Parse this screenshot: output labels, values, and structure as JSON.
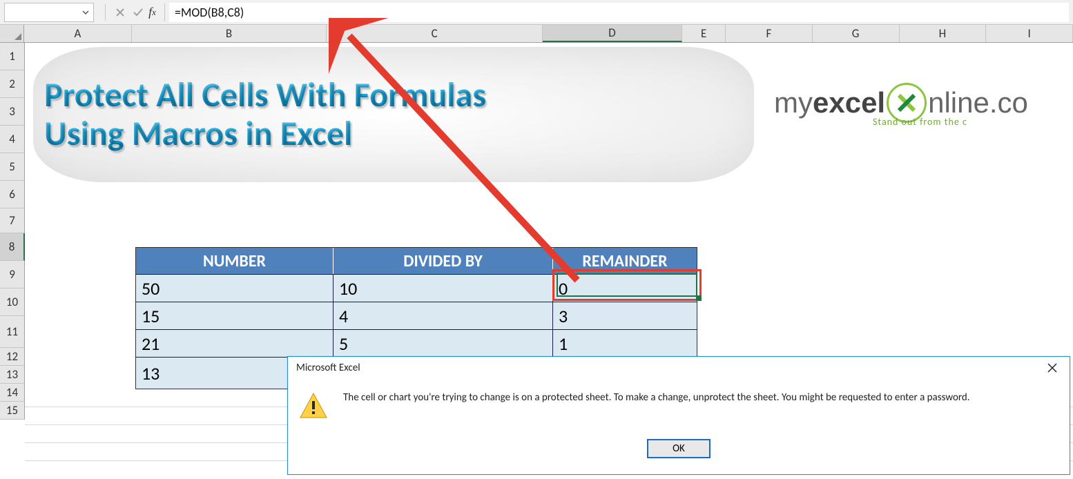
{
  "formula_bar": {
    "name_box_value": "",
    "formula": "=MOD(B8,C8)"
  },
  "columns": [
    "A",
    "B",
    "C",
    "D",
    "E",
    "F",
    "G",
    "H",
    "I"
  ],
  "rows": [
    "1",
    "2",
    "3",
    "4",
    "5",
    "6",
    "7",
    "8",
    "9",
    "10",
    "11",
    "12",
    "13",
    "14",
    "15"
  ],
  "selected_column": "D",
  "selected_row": "8",
  "title_line1": "Protect All Cells With Formulas",
  "title_line2": "Using Macros in Excel",
  "logo": {
    "p1": "my",
    "p2": "excel",
    "p3": "nline.co",
    "tag": "Stand out from the c"
  },
  "table": {
    "headers": {
      "number": "NUMBER",
      "divided_by": "DIVIDED BY",
      "remainder": "REMAINDER"
    },
    "rows": [
      {
        "number": "50",
        "divided_by": "10",
        "remainder": "0"
      },
      {
        "number": "15",
        "divided_by": "4",
        "remainder": "3"
      },
      {
        "number": "21",
        "divided_by": "5",
        "remainder": "1"
      },
      {
        "number": "13",
        "divided_by": "",
        "remainder": ""
      }
    ]
  },
  "dialog": {
    "title": "Microsoft Excel",
    "message": "The cell or chart you're trying to change is on a protected sheet. To make a change, unprotect the sheet. You might be requested to enter a password.",
    "ok": "OK"
  }
}
